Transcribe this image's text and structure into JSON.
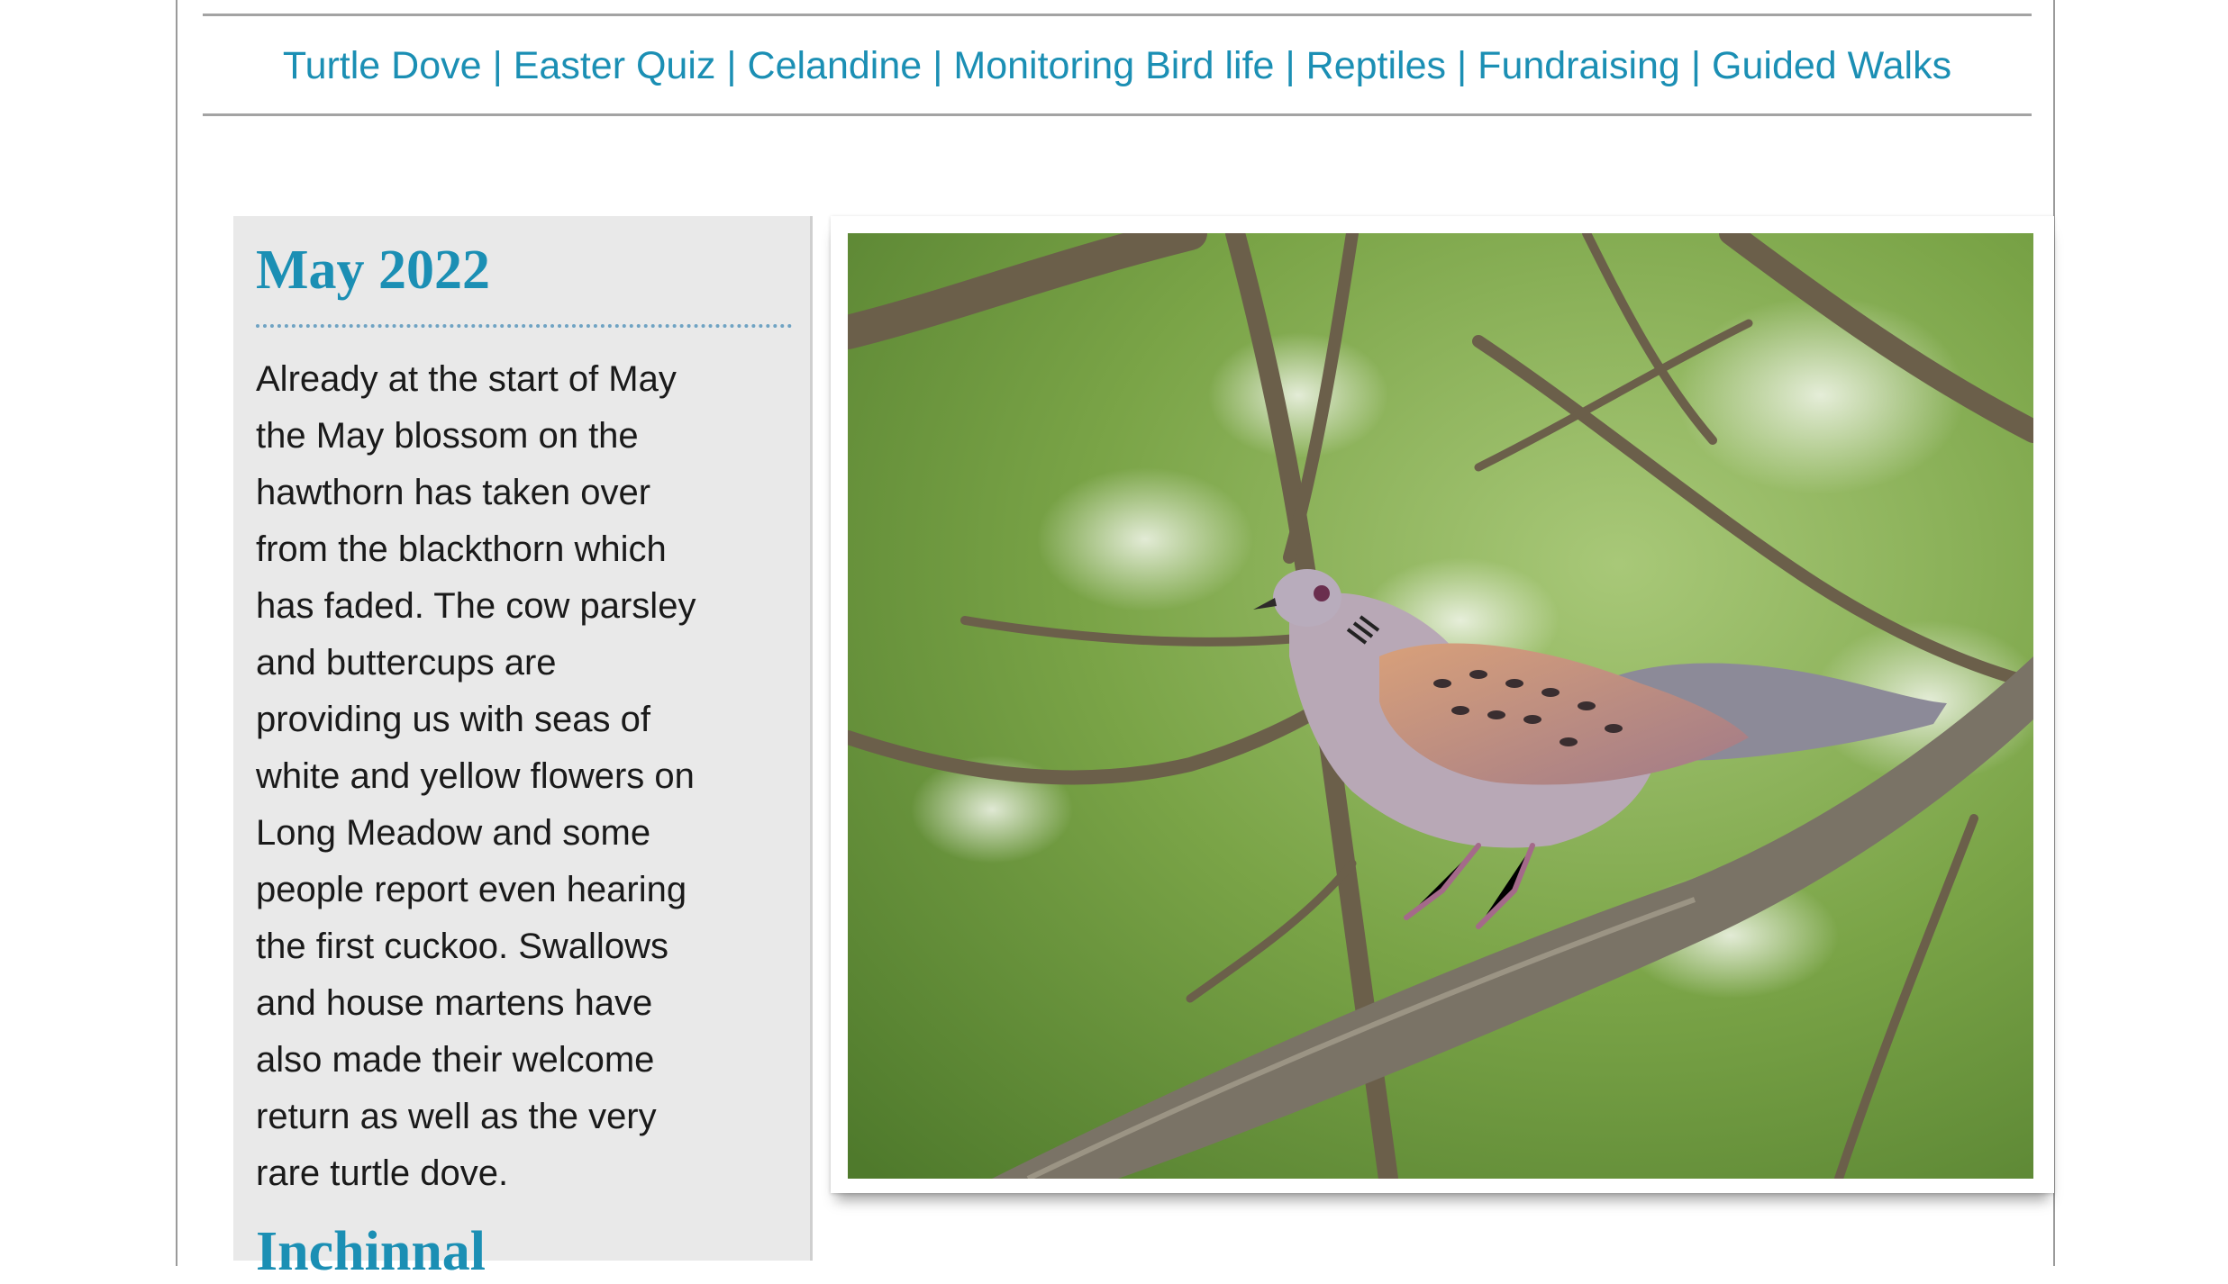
{
  "nav": {
    "items": [
      "Turtle Dove",
      "Easter Quiz",
      "Celandine",
      "Monitoring Bird life",
      "Reptiles",
      "Fundraising",
      "Guided Walks"
    ],
    "separator": "|"
  },
  "sidebar": {
    "title": "May 2022",
    "lines": [
      "Already at the start of May",
      "the May blossom on the",
      "hawthorn has taken over",
      "from the blackthorn which",
      "has faded. The cow parsley",
      "and buttercups are",
      "providing us with seas of",
      "white and yellow flowers on",
      "Long Meadow and some",
      "people report even hearing",
      "the first cuckoo. Swallows",
      "and house martens have",
      "also made their welcome",
      "return as well as the very",
      "rare turtle dove."
    ],
    "next_heading": "Inchinnal"
  },
  "colors": {
    "accent": "#1b8fb4",
    "sidebar_bg": "#e9e9e9",
    "rule": "#a3a3a3"
  },
  "photo": {
    "subject": "turtle-dove-on-branch"
  }
}
